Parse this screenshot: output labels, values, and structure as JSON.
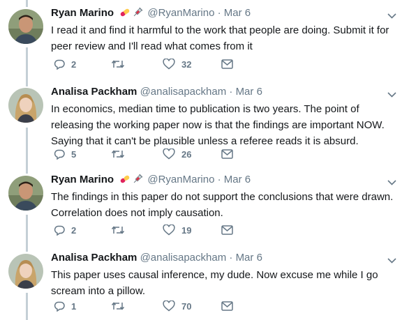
{
  "colors": {
    "thread_line": "#c4cfd6",
    "icon": "#657786",
    "text": "#14171a"
  },
  "tweets": [
    {
      "author": "Ryan Marino",
      "handle": "@RyanMarino",
      "emoji": [
        "pill-icon",
        "syringe-icon"
      ],
      "separator": "·",
      "date": "Mar 6",
      "text": "I read it and find it harmful to the work that people are doing. Submit it for peer review and I'll read what comes from it",
      "replies": "2",
      "retweets": "",
      "likes": "32"
    },
    {
      "author": "Analisa Packham",
      "handle": "@analisapackham",
      "separator": "·",
      "date": "Mar 6",
      "text": "In economics, median time to publication is two years. The point of releasing the working paper now is that the findings are important NOW. Saying that it can't be plausible unless a referee reads it is absurd.",
      "replies": "5",
      "retweets": "",
      "likes": "26"
    },
    {
      "author": "Ryan Marino",
      "handle": "@RyanMarino",
      "emoji": [
        "pill-icon",
        "syringe-icon"
      ],
      "separator": "·",
      "date": "Mar 6",
      "text": "The findings in this paper do not support the conclusions that were drawn. Correlation does not imply causation.",
      "replies": "2",
      "retweets": "",
      "likes": "19"
    },
    {
      "author": "Analisa Packham",
      "handle": "@analisapackham",
      "separator": "·",
      "date": "Mar 6",
      "text": "This paper uses causal inference, my dude. Now excuse me while I go scream into a pillow.",
      "replies": "1",
      "retweets": "",
      "likes": "70"
    }
  ]
}
